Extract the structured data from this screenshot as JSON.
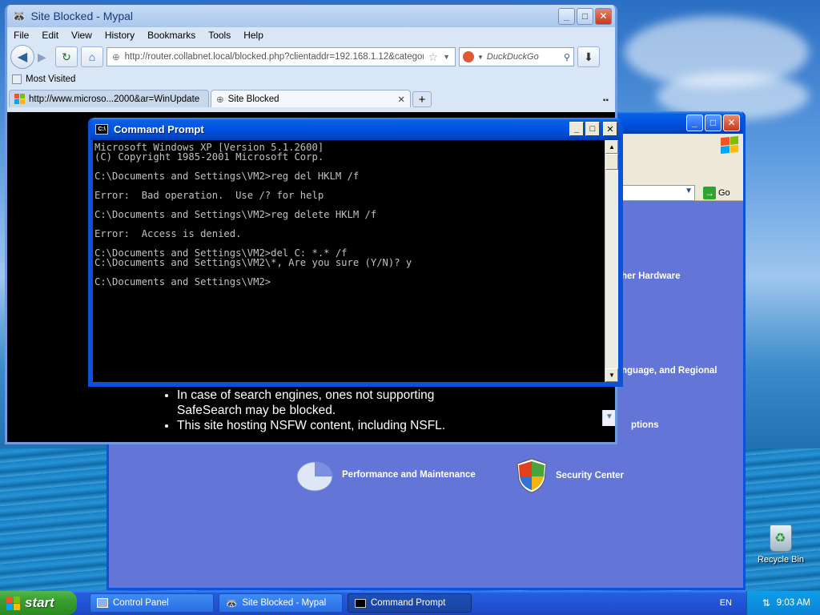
{
  "browser": {
    "title": "Site Blocked - Mypal",
    "menu": [
      "File",
      "Edit",
      "View",
      "History",
      "Bookmarks",
      "Tools",
      "Help"
    ],
    "url": "http://router.collabnet.local/blocked.php?clientaddr=192.168.1.12&categor",
    "search_placeholder": "DuckDuckGo",
    "bookmark_label": "Most Visited",
    "tabs": [
      {
        "label": "http://www.microso...2000&ar=WinUpdate"
      },
      {
        "label": "Site Blocked"
      }
    ],
    "content_bullets": [
      "In case of search engines, ones not supporting SafeSearch may be blocked.",
      "This site hosting NSFW content, including NSFL."
    ]
  },
  "cmd": {
    "title": "Command Prompt",
    "lines": [
      "Microsoft Windows XP [Version 5.1.2600]",
      "(C) Copyright 1985-2001 Microsoft Corp.",
      "",
      "C:\\Documents and Settings\\VM2>reg del HKLM /f",
      "",
      "Error:  Bad operation.  Use /? for help",
      "",
      "C:\\Documents and Settings\\VM2>reg delete HKLM /f",
      "",
      "Error:  Access is denied.",
      "",
      "C:\\Documents and Settings\\VM2>del C: *.* /f",
      "C:\\Documents and Settings\\VM2\\*, Are you sure (Y/N)? y",
      "",
      "C:\\Documents and Settings\\VM2>"
    ]
  },
  "cpanel": {
    "go_label": "Go",
    "categories": {
      "hardware": "her Hardware",
      "regional": "nguage, and Regional",
      "options": "ptions",
      "performance": "Performance and Maintenance",
      "security": "Security Center"
    }
  },
  "desktop": {
    "recycle_bin": "Recycle Bin"
  },
  "taskbar": {
    "start": "start",
    "tasks": [
      "Control Panel",
      "Site Blocked - Mypal",
      "Command Prompt"
    ],
    "lang": "EN",
    "clock": "9:03 AM"
  }
}
